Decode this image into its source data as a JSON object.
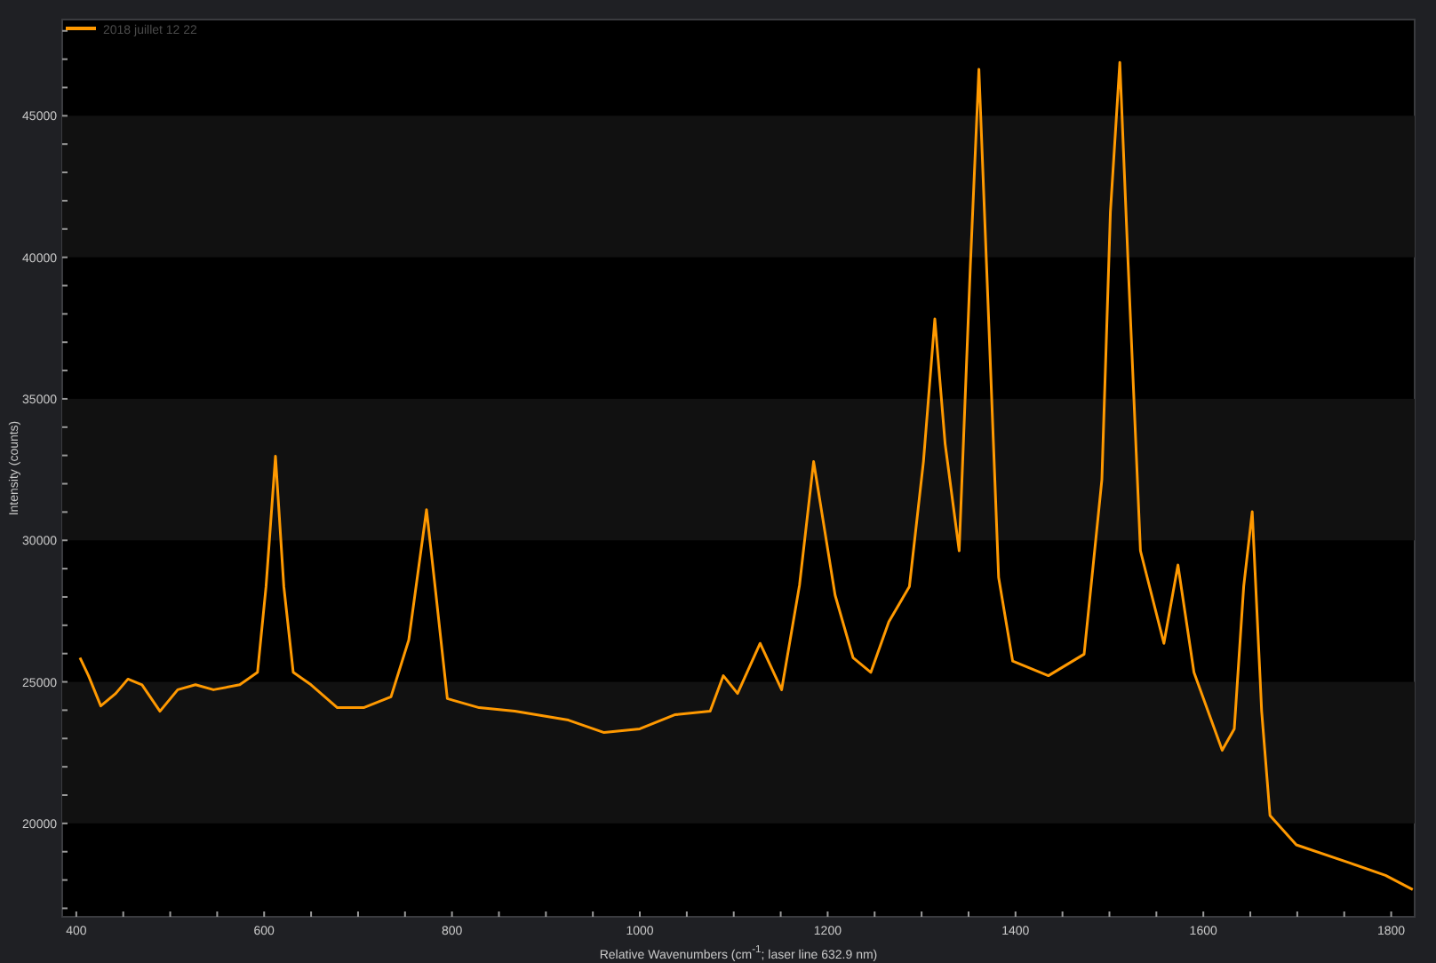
{
  "chart": {
    "chart_data": {
      "type": "line",
      "xlabel": "Relative Wavenumbers (cm$^{-1}$; laser line 632.9 nm)",
      "ylabel": "Intensity (counts)",
      "xlim": [
        385,
        1825
      ],
      "ylim": [
        16700,
        48400
      ],
      "xticks": [
        400,
        600,
        800,
        1000,
        1200,
        1400,
        1600,
        1800
      ],
      "yticks": [
        20000,
        25000,
        30000,
        35000,
        40000,
        45000
      ],
      "x": [
        404,
        413,
        426,
        442,
        455,
        470,
        489,
        508,
        527,
        546,
        574,
        593,
        602,
        612,
        621,
        631,
        650,
        678,
        706,
        735,
        754,
        773,
        782,
        795,
        829,
        867,
        924,
        962,
        1000,
        1037,
        1075,
        1089,
        1104,
        1128,
        1151,
        1170,
        1185,
        1208,
        1227,
        1246,
        1265,
        1287,
        1302,
        1314,
        1325,
        1340,
        1352,
        1361,
        1370,
        1382,
        1397,
        1435,
        1473,
        1492,
        1501,
        1511,
        1520,
        1533,
        1558,
        1573,
        1590,
        1620,
        1633,
        1643,
        1652,
        1662,
        1671,
        1699,
        1756,
        1794,
        1823
      ],
      "series": [
        {
          "name": "2018 juillet 12 22",
          "color": "#ff9900",
          "values": [
            25850,
            25220,
            24150,
            24590,
            25100,
            24900,
            23960,
            24720,
            24900,
            24720,
            24900,
            25340,
            28370,
            32970,
            28370,
            25340,
            24900,
            24090,
            24090,
            24470,
            26480,
            31080,
            28370,
            24410,
            24090,
            23960,
            23650,
            23210,
            23340,
            23840,
            23960,
            25220,
            24590,
            26360,
            24720,
            28430,
            32780,
            28060,
            25850,
            25340,
            27120,
            28370,
            32780,
            37820,
            33410,
            29630,
            39710,
            46640,
            39080,
            28690,
            25730,
            25220,
            25980,
            32150,
            41600,
            46890,
            39710,
            29630,
            26360,
            29130,
            25340,
            22580,
            23340,
            28370,
            31010,
            23960,
            20280,
            19240,
            18600,
            18160,
            17660
          ]
        }
      ]
    }
  }
}
